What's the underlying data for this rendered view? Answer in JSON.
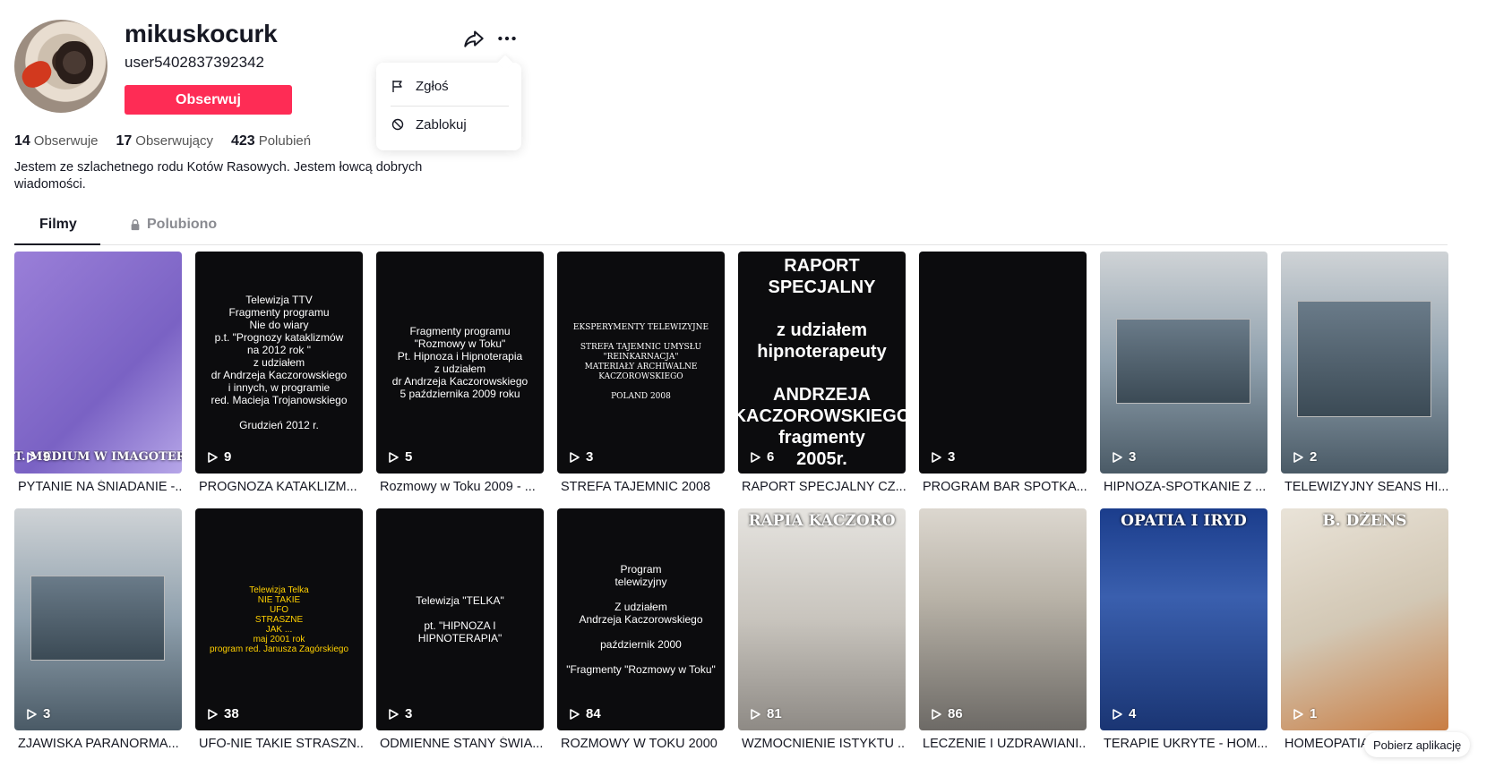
{
  "profile": {
    "username": "mikuskocurk",
    "handle": "user5402837392342",
    "follow_label": "Obserwuj",
    "bio": "Jestem ze szlachetnego rodu Kotów Rasowych. Jestem łowcą dobrych wiadomości.",
    "stats": [
      {
        "value": "14",
        "label": "Obserwuje"
      },
      {
        "value": "17",
        "label": "Obserwujący"
      },
      {
        "value": "423",
        "label": "Polubień"
      }
    ]
  },
  "menu": {
    "items": [
      {
        "label": "Zgłoś",
        "icon": "flag-icon"
      },
      {
        "label": "Zablokuj",
        "icon": "block-icon"
      }
    ]
  },
  "tabs": [
    {
      "label": "Filmy",
      "active": true
    },
    {
      "label": "Polubiono",
      "locked": true
    }
  ],
  "videos": [
    {
      "views": "9",
      "caption": "PYTANIE NA ŚNIADANIE -...",
      "thumb_text": "",
      "overlay": "T. MEDIUM W IMAGOTERAP"
    },
    {
      "views": "9",
      "caption": "PROGNOZA KATAKLIZM...",
      "thumb_text": "Telewizja TTV\nFragmenty programu\nNie do wiary\np.t. \"Prognozy kataklizmów\nna 2012 rok \"\nz udziałem\ndr Andrzeja Kaczorowskiego\ni innych, w programie\nred. Macieja Trojanowskiego\n\nGrudzień 2012 r."
    },
    {
      "views": "5",
      "caption": "Rozmowy w Toku 2009 - ...",
      "thumb_text": "Fragmenty programu\n\"Rozmowy w Toku\"\nPt. Hipnoza i Hipnoterapia\nz udziałem\ndr Andrzeja Kaczorowskiego\n5 października 2009 roku"
    },
    {
      "views": "3",
      "caption": "STREFA TAJEMNIC 2008",
      "thumb_text": "EKSPERYMENTY TELEWIZYJNE\n\nSTREFA TAJEMNIC UMYSŁU\n\"REINKARNACJA\"\nMATERIAŁY ARCHIWALNE\nKACZOROWSKIEGO\n\nPOLAND 2008"
    },
    {
      "views": "6",
      "caption": "RAPORT SPECJALNY CZ....",
      "thumb_text": "RAPORT\nSPECJALNY\n\nz udziałem\nhipnoterapeuty\n\nANDRZEJA\nKACZOROWSKIEGO\nfragmenty\n2005r."
    },
    {
      "views": "3",
      "caption": "PROGRAM BAR SPOTKA...",
      "thumb_text": ""
    },
    {
      "views": "3",
      "caption": "HIPNOZA-SPOTKANIE Z ...",
      "thumb_text": ""
    },
    {
      "views": "2",
      "caption": "TELEWIZYJNY SEANS HI...",
      "thumb_text": ""
    },
    {
      "views": "3",
      "caption": "ZJAWISKA PARANORMA...",
      "thumb_text": ""
    },
    {
      "views": "38",
      "caption": "UFO-NIE TAKIE STRASZN...",
      "thumb_text": "Telewizja Telka\nNIE TAKIE\nUFO\nSTRASZNE\nJAK ...\nmaj 2001 rok\nprogram red. Janusza Zagórskiego"
    },
    {
      "views": "3",
      "caption": "ODMIENNE STANY ŚWIA...",
      "thumb_text": "Telewizja \"TELKA\"\n\npt. \"HIPNOZA I HIPNOTERAPIA\""
    },
    {
      "views": "84",
      "caption": "ROZMOWY W TOKU 2000",
      "thumb_text": "Program\ntelewizyjny\n\nZ udziałem\nAndrzeja Kaczorowskiego\n\npaździernik 2000\n\n\"Fragmenty \"Rozmowy w Toku\""
    },
    {
      "views": "81",
      "caption": "WZMOCNIENIE ISTYKTU ...",
      "thumb_text": "",
      "overlay": "RAPIA KACZORO"
    },
    {
      "views": "86",
      "caption": "LECZENIE I UZDRAWIANI...",
      "thumb_text": ""
    },
    {
      "views": "4",
      "caption": "TERAPIE UKRYTE - HOM...",
      "thumb_text": "",
      "overlay": "OPATIA I IRYD"
    },
    {
      "views": "1",
      "caption": "HOMEOPATIA-",
      "thumb_text": "",
      "overlay": "B. DŻENS"
    }
  ],
  "get_app_label": "Pobierz aplikację"
}
